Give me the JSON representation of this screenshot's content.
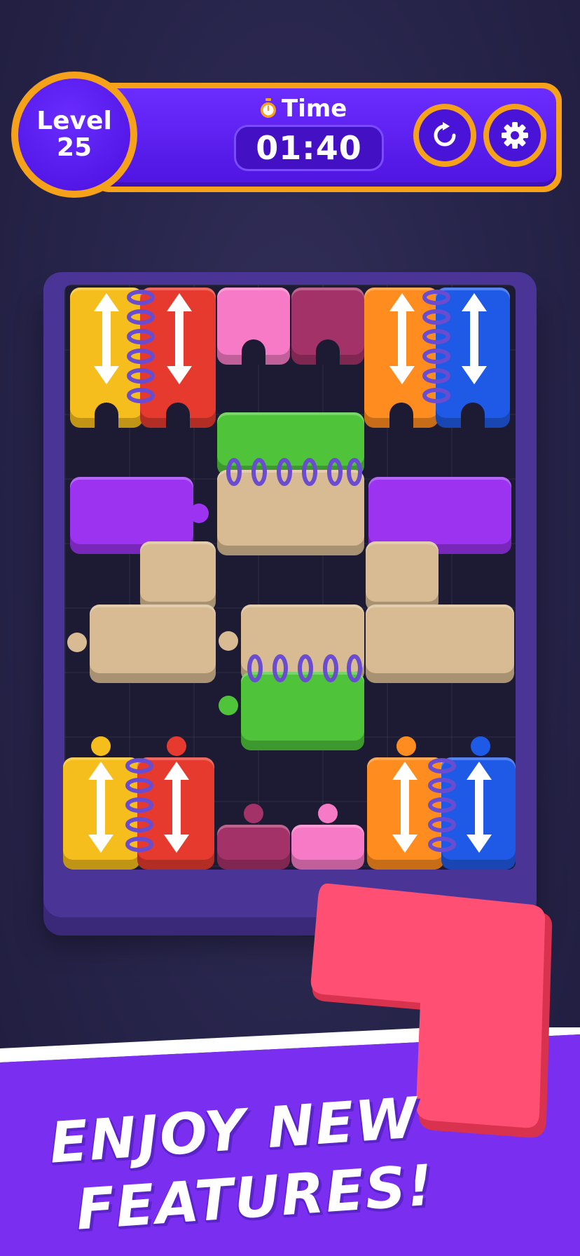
{
  "hud": {
    "level_label": "Level",
    "level_number": "25",
    "time_label": "Time",
    "time_value": "01:40"
  },
  "icons": {
    "timer": "stopwatch-icon",
    "restart": "restart-icon",
    "settings": "gear-icon"
  },
  "colors": {
    "background": "#27244a",
    "hud_purple": "#4f14e0",
    "hud_border": "#f6a11a",
    "board_frame": "#4a3596",
    "yellow": "#f6be1c",
    "red": "#e53a2d",
    "pink": "#f77ac6",
    "maroon": "#a33268",
    "orange": "#ff8c1e",
    "blue": "#1f5ae6",
    "green": "#4fc43a",
    "tan": "#d8bb93",
    "violet": "#9b33f0",
    "coral": "#ff4f73",
    "promo_purple": "#7a2ff0"
  },
  "promo": {
    "line1": "ENJOY NEW",
    "line2": "FEATURES!"
  }
}
